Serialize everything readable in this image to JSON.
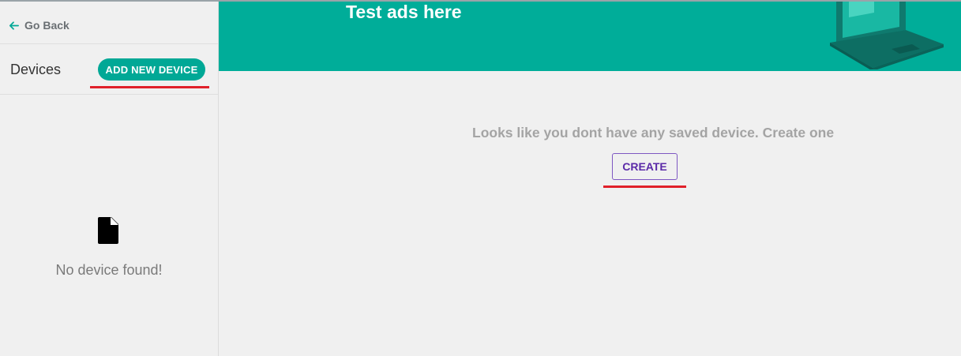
{
  "sidebar": {
    "back_label": "Go Back",
    "title": "Devices",
    "add_button_label": "ADD NEW DEVICE",
    "empty_message": "No device found!",
    "empty_icon": "file-icon"
  },
  "banner": {
    "title": "Test ads here",
    "background_color": "#00ad99"
  },
  "main": {
    "empty_message": "Looks like you dont have any saved device. Create one",
    "create_button_label": "CREATE"
  },
  "colors": {
    "accent": "#00a896",
    "highlight_underline": "#e0202a",
    "create_button_text": "#5b2aa8"
  }
}
